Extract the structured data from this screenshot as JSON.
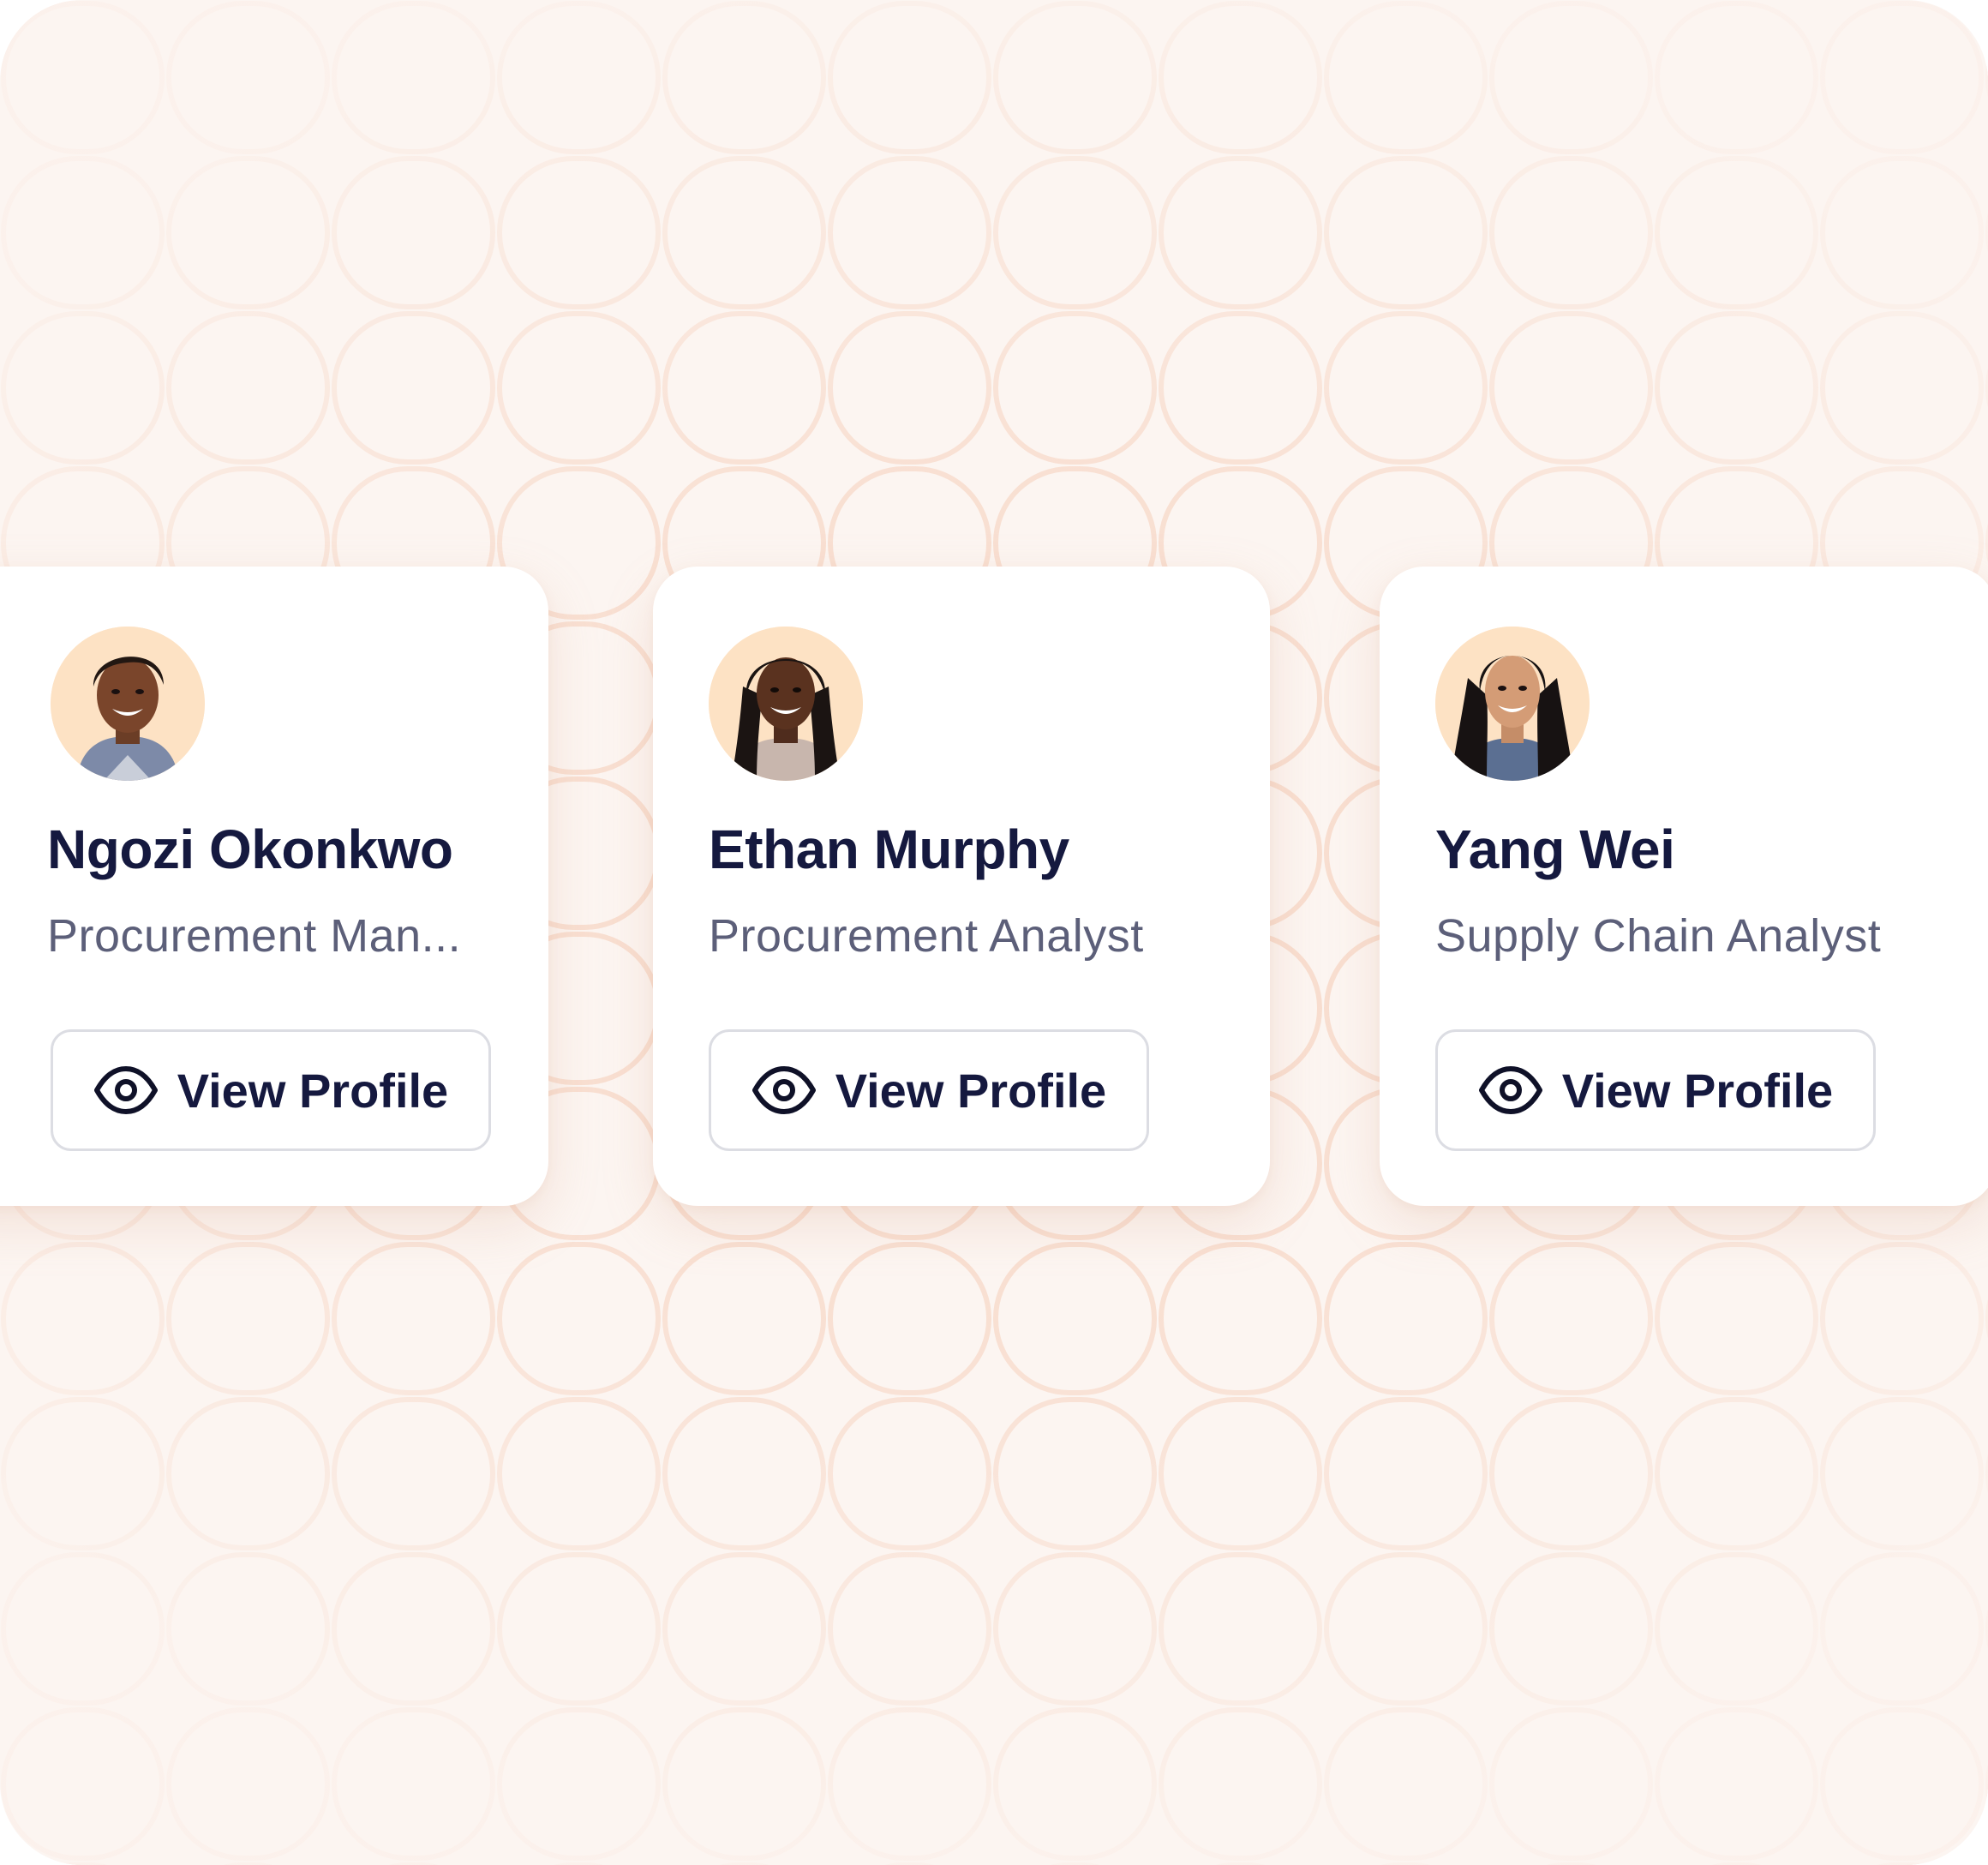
{
  "profiles": [
    {
      "name": "Ngozi Okonkwo",
      "role": "Procurement Man...",
      "button_label": "View Profile",
      "avatar_icon": "woman-short-hair-avatar"
    },
    {
      "name": "Ethan Murphy",
      "role": "Procurement Analyst",
      "button_label": "View Profile",
      "avatar_icon": "woman-braids-avatar"
    },
    {
      "name": "Yang Wei",
      "role": "Supply Chain Analyst",
      "button_label": "View Profile",
      "avatar_icon": "woman-long-hair-avatar"
    }
  ],
  "colors": {
    "background": "#fcf5f1",
    "pattern_stroke": "#f7d9c9",
    "card": "#ffffff",
    "name_text": "#15193f",
    "role_text": "#5c5f79",
    "button_border": "#dcdde3",
    "avatar_bg": "#fde2c4"
  }
}
